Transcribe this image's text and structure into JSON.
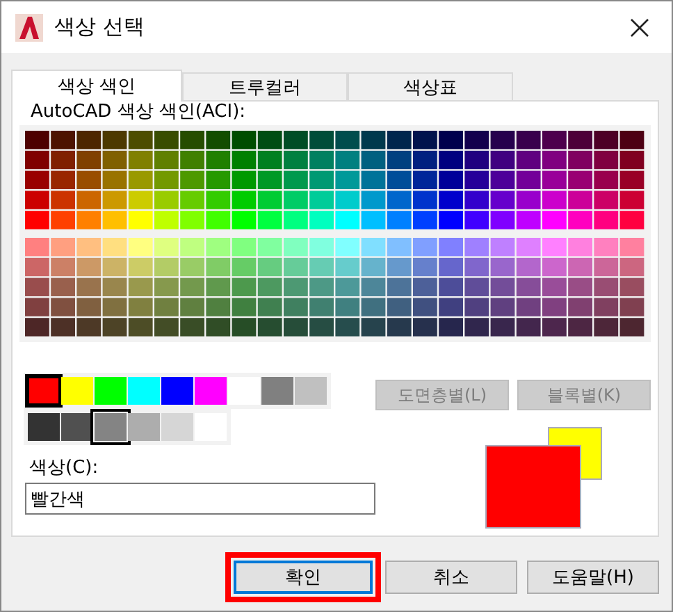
{
  "window": {
    "title": "색상 선택"
  },
  "tabs": [
    {
      "label": "색상 색인",
      "selected": true
    },
    {
      "label": "트루컬러",
      "selected": false
    },
    {
      "label": "색상표",
      "selected": false
    }
  ],
  "palette_label": "AutoCAD 색상 색인(ACI):",
  "standard_colors": [
    {
      "color": "#ff0000",
      "selected": true
    },
    {
      "color": "#ffff00",
      "selected": false
    },
    {
      "color": "#00ff00",
      "selected": false
    },
    {
      "color": "#00ffff",
      "selected": false
    },
    {
      "color": "#0000ff",
      "selected": false
    },
    {
      "color": "#ff00ff",
      "selected": false
    },
    {
      "color": "#ffffff",
      "selected": false
    },
    {
      "color": "#808080",
      "selected": false
    },
    {
      "color": "#c0c0c0",
      "selected": false
    }
  ],
  "gray_colors": [
    {
      "color": "#333333",
      "highlighted": false
    },
    {
      "color": "#505050",
      "highlighted": false
    },
    {
      "color": "#848484",
      "highlighted": true
    },
    {
      "color": "#adadad",
      "highlighted": false
    },
    {
      "color": "#d6d6d6",
      "highlighted": false
    },
    {
      "color": "#ffffff",
      "highlighted": false
    }
  ],
  "side_buttons": [
    {
      "label": "도면층별(L)",
      "disabled": true
    },
    {
      "label": "블록별(K)",
      "disabled": true
    }
  ],
  "color_field": {
    "label": "색상(C):",
    "value": "빨간색"
  },
  "preview_swatches": [
    {
      "kind": "previous",
      "color": "#ffff00"
    },
    {
      "kind": "current",
      "color": "#ff0000"
    }
  ],
  "buttons": [
    {
      "label": "확인",
      "focused": true,
      "annotated": true
    },
    {
      "label": "취소",
      "focused": false,
      "annotated": false
    },
    {
      "label": "도움말(H)",
      "focused": false,
      "annotated": false
    }
  ]
}
